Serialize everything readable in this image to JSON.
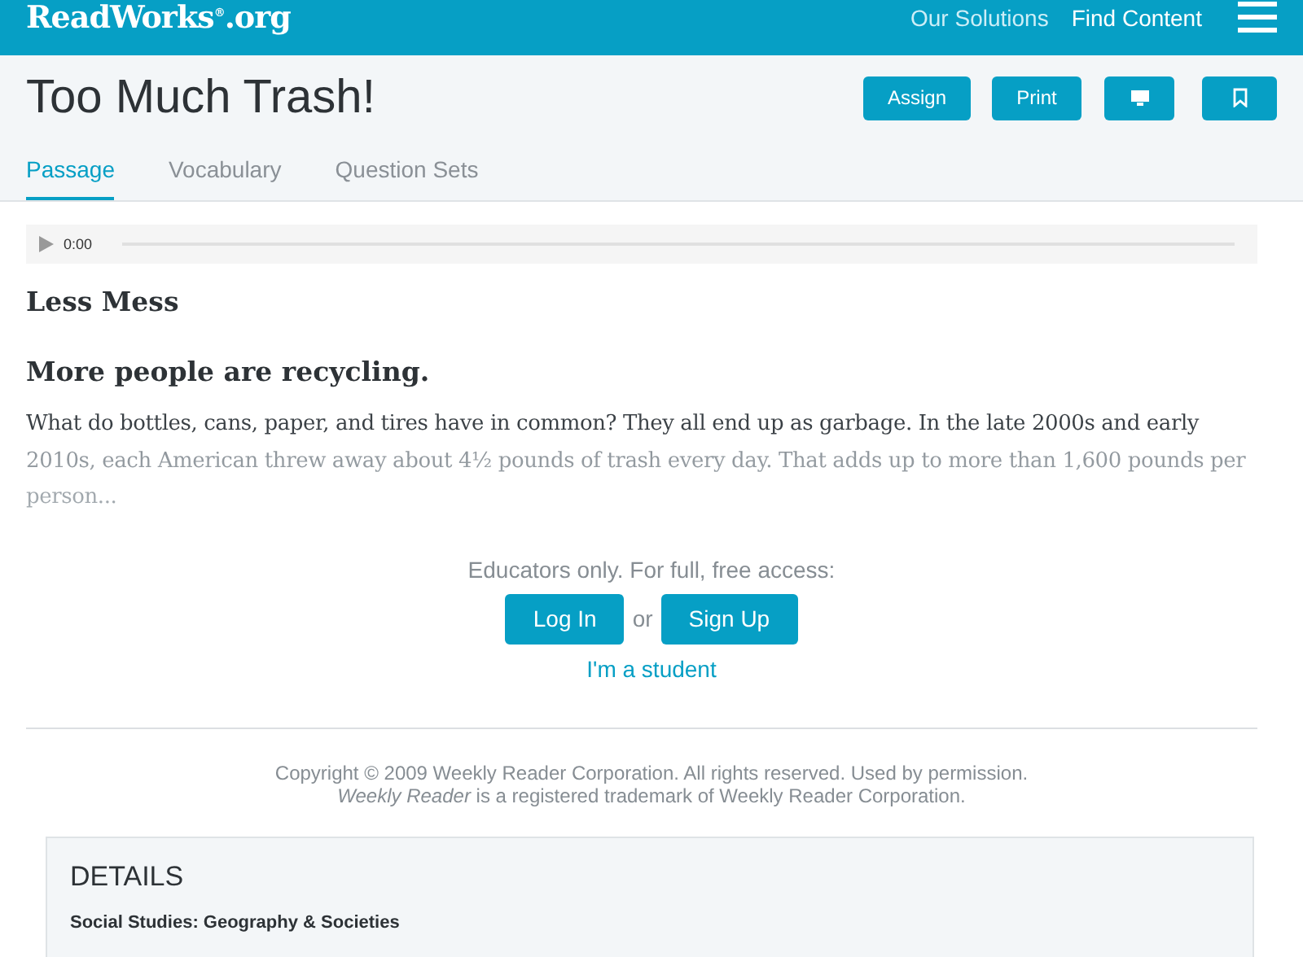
{
  "header": {
    "logo": "ReadWorks",
    "logo_mark": "®",
    "logo_suffix": ".org",
    "nav": [
      "Our Solutions",
      "Find Content"
    ]
  },
  "title": "Too Much Trash!",
  "actions": [
    {
      "kind": "text",
      "label": "Assign"
    },
    {
      "kind": "text",
      "label": "Print"
    },
    {
      "kind": "monitor"
    },
    {
      "kind": "bookmark"
    }
  ],
  "tabs": [
    {
      "label": "Passage",
      "selected": true
    },
    {
      "label": "Vocabulary",
      "selected": false
    },
    {
      "label": "Question Sets",
      "selected": false
    }
  ],
  "audio": {
    "time": "0:00"
  },
  "passage": {
    "heading": "Less Mess",
    "subheading": "More people are recycling.",
    "text": "What do bottles, cans, paper, and tires have in common? They all end up as garbage. In the late 2000s and early 2010s, each American threw away about 4½ pounds of trash every day. That adds up to more than 1,600 pounds per person..."
  },
  "access": {
    "prompt": "Educators only. For full, free access:",
    "login": "Log In",
    "or": "or",
    "signup": "Sign Up",
    "student": "I'm a student"
  },
  "copyright": {
    "line1": "Copyright © 2009 Weekly Reader Corporation. All rights reserved. Used by permission.",
    "line2": "*Weekly Reader* is a registered trademark of Weekly Reader Corporation."
  },
  "details": {
    "title": "DETAILS",
    "subject": "Social Studies: Geography & Societies"
  }
}
